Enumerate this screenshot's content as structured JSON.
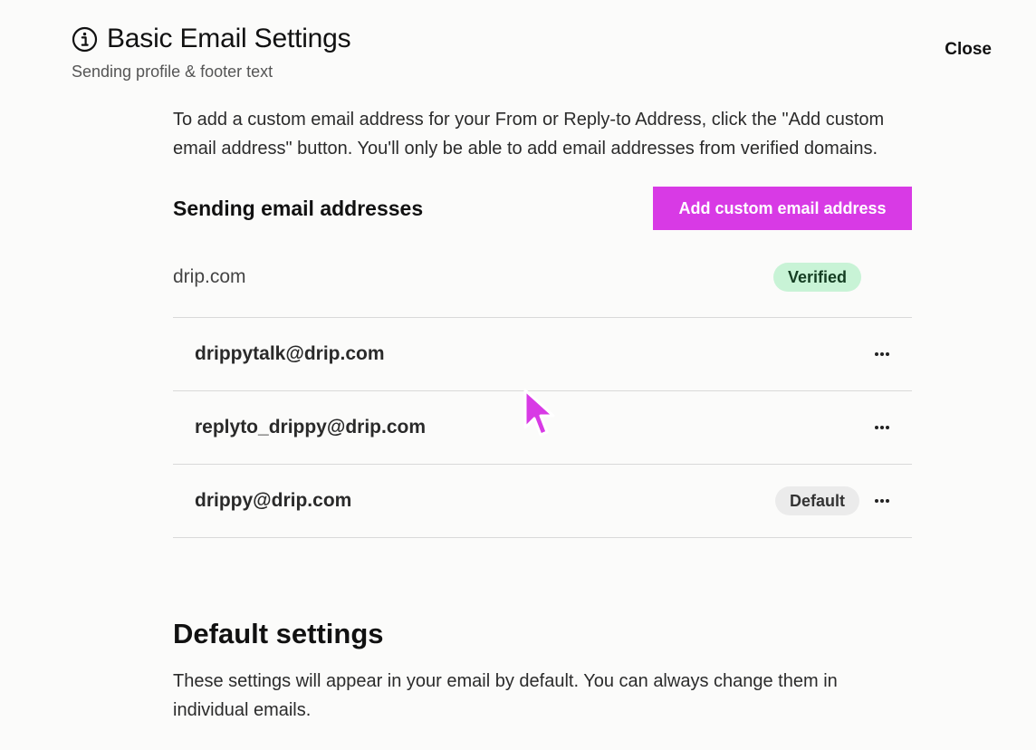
{
  "header": {
    "title": "Basic Email Settings",
    "subtitle": "Sending profile & footer text",
    "close_label": "Close"
  },
  "intro": "To add a custom email address for your From or Reply-to Address, click the \"Add custom email address\" button. You'll only be able to add email addresses from verified domains.",
  "sending": {
    "title": "Sending email addresses",
    "add_button": "Add custom email address",
    "domain": "drip.com",
    "domain_status": "Verified",
    "emails": [
      {
        "address": "drippytalk@drip.com",
        "badge": ""
      },
      {
        "address": "replyto_drippy@drip.com",
        "badge": ""
      },
      {
        "address": "drippy@drip.com",
        "badge": "Default"
      }
    ]
  },
  "defaults": {
    "title": "Default settings",
    "description": "These settings will appear in your email by default. You can always change them in individual emails."
  },
  "colors": {
    "accent": "#d83ae5",
    "verified_bg": "#c8f3d6",
    "default_bg": "#ebebeb"
  },
  "icons": {
    "info": "info-circle-icon",
    "more": "more-horizontal-icon",
    "cursor": "mouse-pointer-icon"
  }
}
